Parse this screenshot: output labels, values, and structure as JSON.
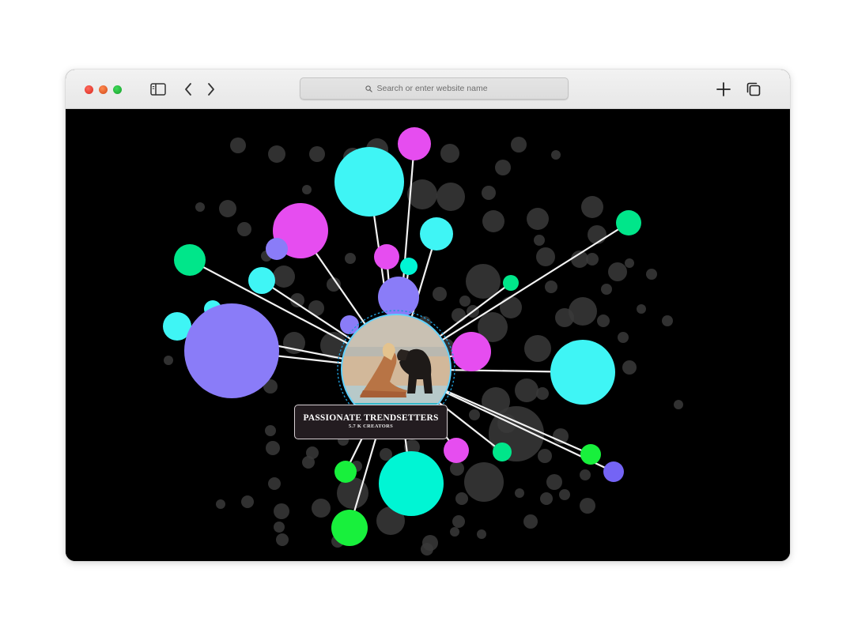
{
  "browser": {
    "address_placeholder": "Search or enter website name",
    "icons": {
      "sidebar": "sidebar-icon",
      "back": "chevron-left-icon",
      "forward": "chevron-right-icon",
      "search": "search-icon",
      "new_tab": "plus-icon",
      "tabs": "tab-overview-icon"
    }
  },
  "visualization": {
    "center_node": {
      "title": "PASSIONATE TRENDSETTERS",
      "subtitle": "5.7 K CREATORS",
      "image": "woman-with-dog-photo"
    },
    "colors": {
      "background": "#000000",
      "cyan": "#3ff5f5",
      "aqua": "#00f5d4",
      "magenta": "#e64df0",
      "violet": "#8a7cf8",
      "green": "#00e68a",
      "lime": "#18f03c",
      "blue": "#7464f5",
      "link": "#f2f2f2",
      "inactive": "#3a3a3a"
    }
  }
}
